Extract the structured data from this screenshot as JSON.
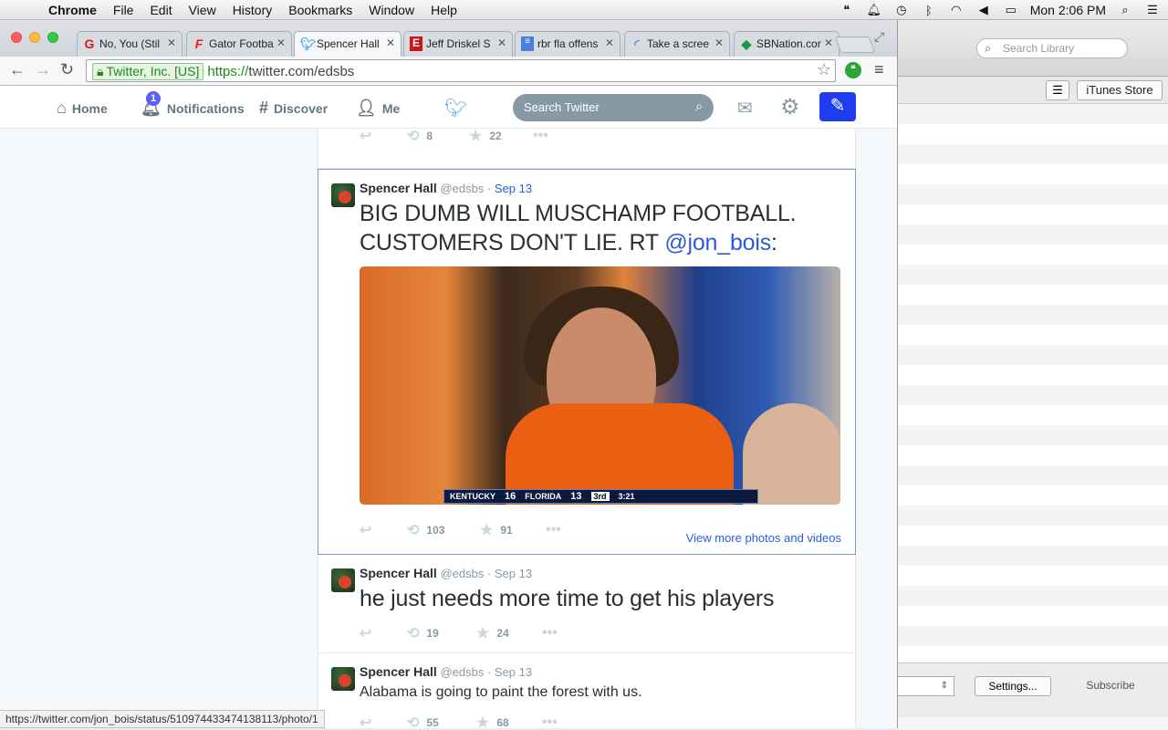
{
  "menubar": {
    "app": "Chrome",
    "items": [
      "File",
      "Edit",
      "View",
      "History",
      "Bookmarks",
      "Window",
      "Help"
    ],
    "clock": "Mon 2:06 PM"
  },
  "tabs": [
    {
      "label": "No, You (Stil",
      "favicon": "G",
      "color": "#d81b1b"
    },
    {
      "label": "Gator Footba",
      "favicon": "F",
      "color": "#e02020"
    },
    {
      "label": "Spencer Hall",
      "favicon": "twitter-bird",
      "color": "#55acee",
      "active": true
    },
    {
      "label": "Jeff Driskel S",
      "favicon": "E",
      "color": "#d0121b"
    },
    {
      "label": "rbr fla offens",
      "favicon": "doc",
      "color": "#4a7fe0"
    },
    {
      "label": "Take a scree",
      "favicon": "loading",
      "color": "#4a90e2"
    },
    {
      "label": "SBNation.cor",
      "favicon": "sbn",
      "color": "#1b9a45"
    }
  ],
  "omnibox": {
    "ev_label": "Twitter, Inc. [US]",
    "scheme": "https://",
    "url_rest": "twitter.com/edsbs"
  },
  "twitter_nav": {
    "home": "Home",
    "notifications": "Notifications",
    "notification_count": "1",
    "discover": "Discover",
    "me": "Me",
    "search_placeholder": "Search Twitter"
  },
  "prev_tweet_stats": {
    "retweets": "8",
    "favorites": "22"
  },
  "tweets": [
    {
      "name": "Spencer Hall",
      "handle": "@edsbs",
      "date": "Sep 13",
      "text_main": "BIG DUMB WILL MUSCHAMP FOOTBALL. CUSTOMERS DON'T LIE. RT ",
      "mention": "@jon_bois",
      "text_tail": ":",
      "retweets": "103",
      "favorites": "91",
      "view_more": "View more photos and videos",
      "scorebug": {
        "team1": "KENTUCKY",
        "score1": "16",
        "team2": "FLORIDA",
        "score2": "13",
        "quarter": "3rd",
        "clock": "3:21"
      }
    },
    {
      "name": "Spencer Hall",
      "handle": "@edsbs",
      "date": "Sep 13",
      "text": "he just needs more time to get his players",
      "retweets": "19",
      "favorites": "24"
    },
    {
      "name": "Spencer Hall",
      "handle": "@edsbs",
      "date": "Sep 13",
      "text": "Alabama is going to paint the forest with us.",
      "retweets": "55",
      "favorites": "68"
    }
  ],
  "status_url": "https://twitter.com/jon_bois/status/510974433474138113/photo/1",
  "itunes": {
    "search_placeholder": "Search Library",
    "store_button": "iTunes Store",
    "settings_button": "Settings...",
    "subscribe_button": "Subscribe"
  },
  "colors": {
    "twitter_blue": "#55acee",
    "link_blue": "#2b5adf",
    "compose_blue": "#1f3cf0"
  }
}
